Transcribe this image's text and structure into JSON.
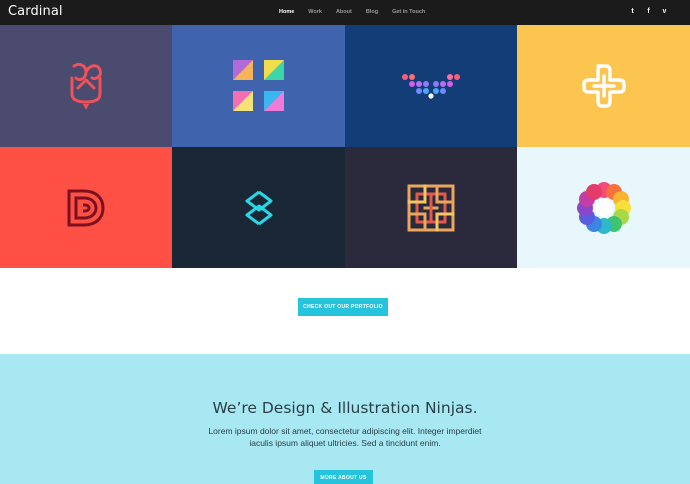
{
  "header": {
    "brand": "Cardinal",
    "nav": [
      "Home",
      "Work",
      "About",
      "Blog",
      "Get in Touch"
    ],
    "active_nav": "Home",
    "social": [
      "twitter-icon",
      "facebook-icon",
      "vimeo-icon"
    ],
    "social_glyphs": [
      "t",
      "f",
      "v"
    ],
    "background": "#1b1b1b"
  },
  "portfolio": {
    "tiles": [
      {
        "name": "tile-feather-pen",
        "bg": "#4a4b6e",
        "icon": "feather-pen-logo-icon"
      },
      {
        "name": "tile-color-blocks",
        "bg": "#3f64ad",
        "icon": "four-squares-logo-icon"
      },
      {
        "name": "tile-dots-v",
        "bg": "#133d77",
        "icon": "dotted-v-logo-icon"
      },
      {
        "name": "tile-cross",
        "bg": "#fcc54f",
        "icon": "rounded-cross-logo-icon"
      },
      {
        "name": "tile-letter-d",
        "bg": "#fe5045",
        "icon": "letter-d-logo-icon"
      },
      {
        "name": "tile-letter-s",
        "bg": "#1a2736",
        "icon": "letter-s-logo-icon"
      },
      {
        "name": "tile-maze",
        "bg": "#2b2a3d",
        "icon": "maze-logo-icon"
      },
      {
        "name": "tile-flower",
        "bg": "#e7f7fb",
        "icon": "color-flower-logo-icon"
      }
    ],
    "cta_label": "CHECK OUT OUR PORTFOLIO"
  },
  "about": {
    "heading": "We’re Design & Illustration Ninjas.",
    "body": "Lorem ipsum dolor sit amet, consectetur adipiscing elit. Integer imperdiet iaculis ipsum aliquet ultricies. Sed a tincidunt enim.",
    "button_label": "MORE ABOUT US",
    "background": "#a7e8f3",
    "accent": "#26c3dc"
  }
}
